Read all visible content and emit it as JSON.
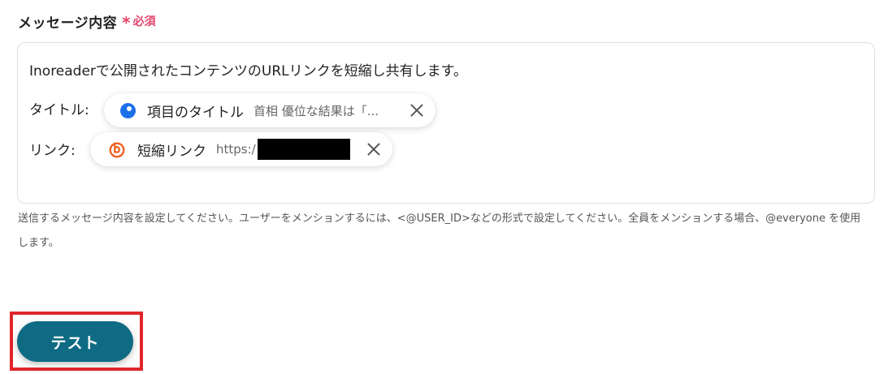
{
  "field": {
    "label": "メッセージ内容",
    "required_mark": "*",
    "required_text": "必須"
  },
  "message": {
    "text": "Inoreaderで公開されたコンテンツのURLリンクを短縮し共有します。",
    "title_label": "タイトル:",
    "link_label": "リンク:",
    "title_chip": {
      "name": "項目のタイトル",
      "value": "首相 優位な結果は「...",
      "icon": "inoreader-dot-icon"
    },
    "link_chip": {
      "name": "短縮リンク",
      "value": "https:/",
      "icon": "bitly-icon",
      "brand_color": "#ee6123"
    }
  },
  "help_text": "送信するメッセージ内容を設定してください。ユーザーをメンションするには、<@USER_ID>などの形式で設定してください。全員をメンションする場合、@everyone を使用します。",
  "actions": {
    "test_label": "テスト",
    "test_color": "#0f6b84",
    "highlight_color": "#e0262a"
  }
}
